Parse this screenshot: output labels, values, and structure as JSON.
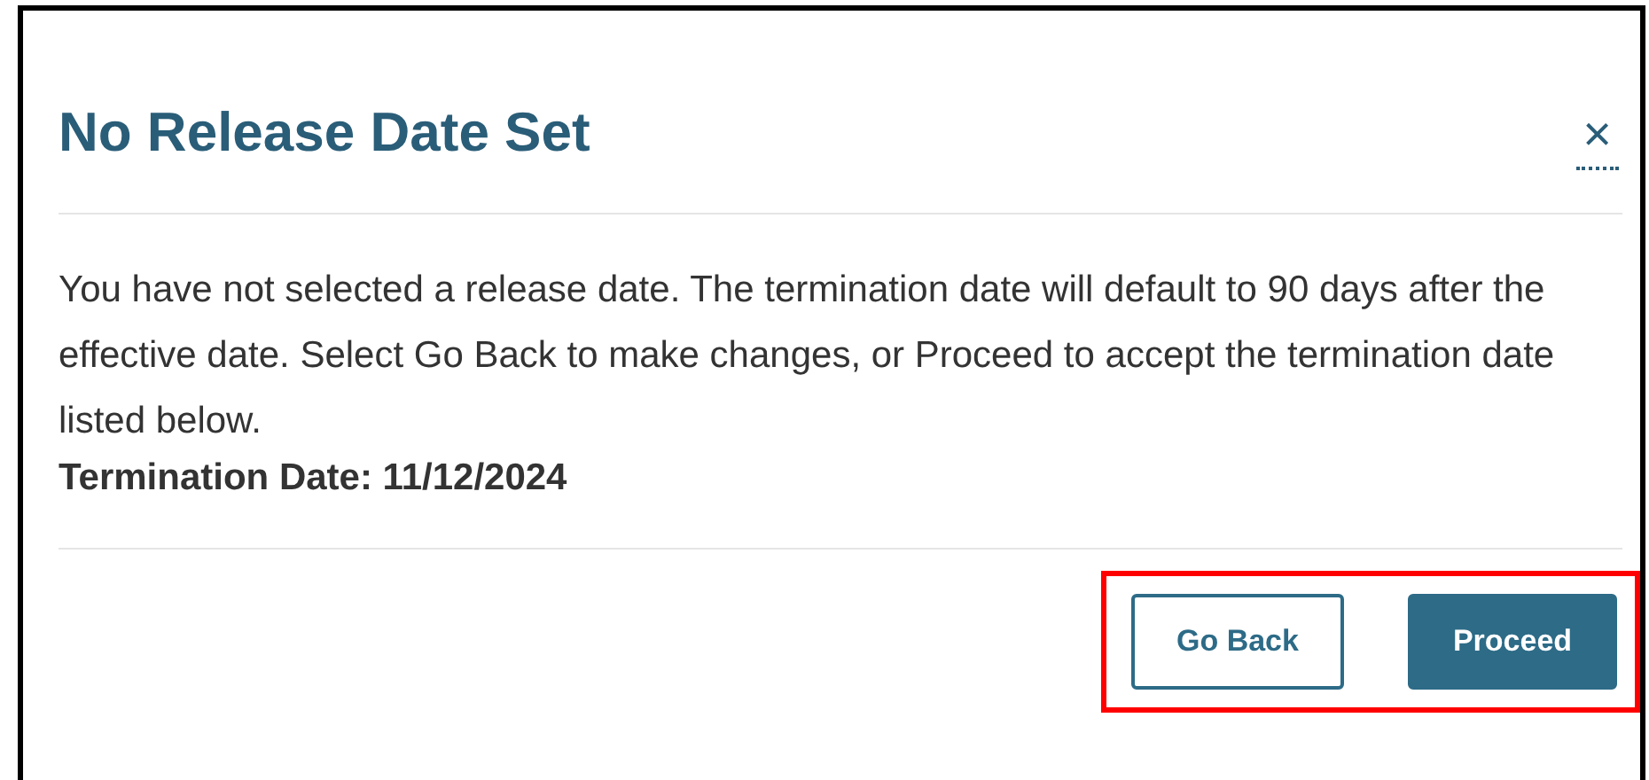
{
  "dialog": {
    "title": "No Release Date Set",
    "close": "×",
    "message": "You have not selected a release date. The termination date will default to 90 days after the effective date. Select Go Back to make changes, or Proceed to accept the termination date listed below.",
    "termination": "Termination Date: 11/12/2024",
    "buttons": [
      {
        "label": "Go Back",
        "kind": "secondary"
      },
      {
        "label": "Proceed",
        "kind": "primary"
      }
    ],
    "highlight": {
      "color": "#ff0000"
    }
  }
}
